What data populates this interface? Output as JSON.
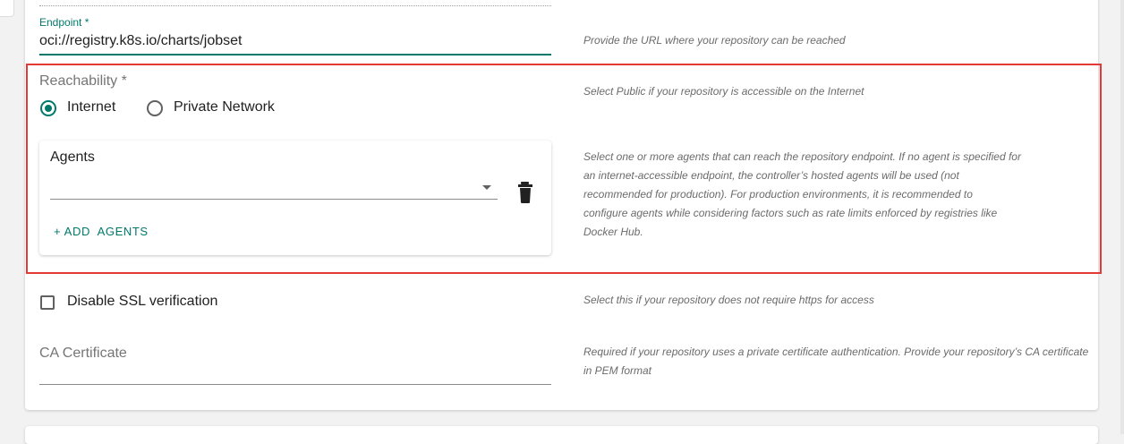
{
  "endpoint": {
    "label": "Endpoint *",
    "value": "oci://registry.k8s.io/charts/jobset",
    "help": "Provide the URL where your repository can be reached"
  },
  "reachability": {
    "label": "Reachability *",
    "options": [
      {
        "label": "Internet",
        "selected": true
      },
      {
        "label": "Private Network",
        "selected": false
      }
    ],
    "help": "Select Public if your repository is accessible on the Internet"
  },
  "agents": {
    "title": "Agents",
    "select_value": "",
    "add_label": "+ ADD  AGENTS",
    "delete_icon": "trash-icon",
    "help_lines": [
      "Select one or more agents that can reach the repository endpoint. If no agent is specified for",
      "an internet-accessible endpoint, the controller’s hosted agents will be used (not",
      "recommended for production). For production environments, it is recommended to",
      "configure agents while considering factors such as rate limits enforced by registries like",
      "Docker Hub."
    ]
  },
  "ssl": {
    "label": "Disable SSL verification",
    "checked": false,
    "help": "Select this if your repository does not require https for access"
  },
  "ca_certificate": {
    "label": "CA Certificate",
    "value": "",
    "help_lines": [
      "Required if your repository uses a private certificate authentication. Provide your repository’s CA certificate",
      "in PEM format"
    ]
  },
  "colors": {
    "accent": "#00796b",
    "highlight": "#e53935"
  }
}
